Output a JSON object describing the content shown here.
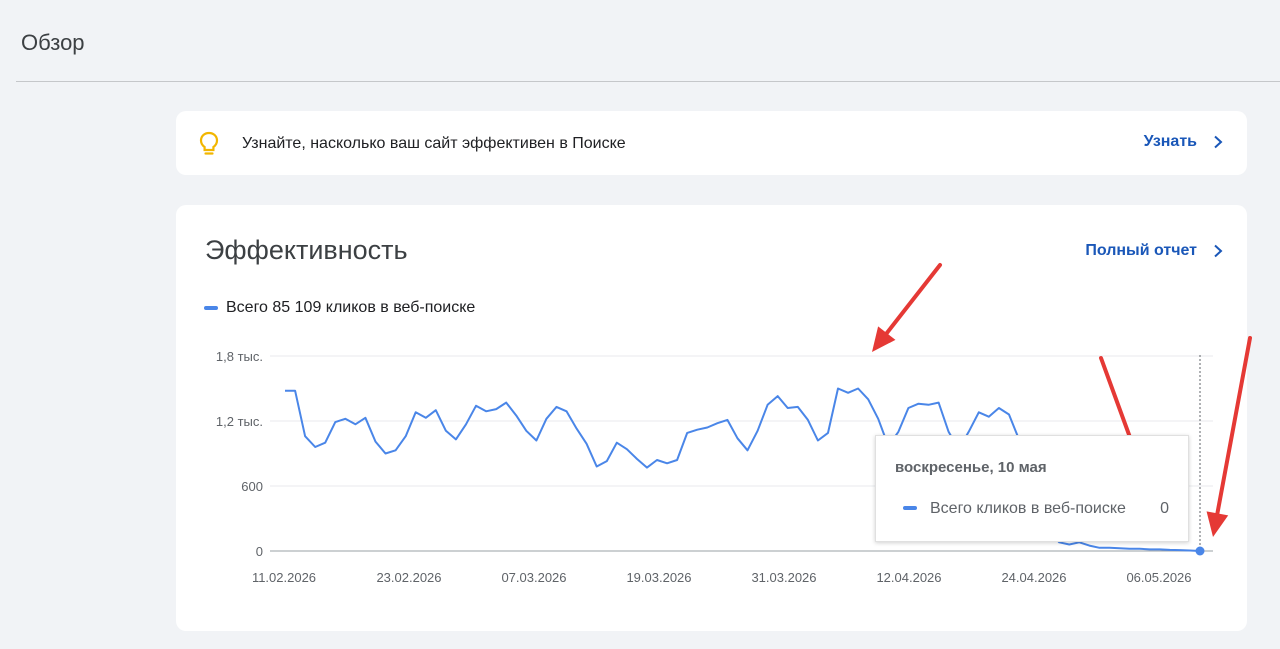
{
  "page": {
    "title": "Обзор"
  },
  "tip": {
    "icon": "lightbulb-icon",
    "icon_color": "#f2b600",
    "text": "Узнайте, насколько ваш сайт эффективен в Поиске",
    "link_label": "Узнать"
  },
  "performance": {
    "title": "Эффективность",
    "link_label": "Полный отчет",
    "legend_label": "Всего 85 109 кликов в веб-поиске",
    "accent": "#1a57b8",
    "series_color": "#4a86e8"
  },
  "tooltip": {
    "date": "воскресенье, 10 мая",
    "label": "Всего кликов в веб-поиске",
    "value": "0"
  },
  "chart_data": {
    "type": "line",
    "ylim": [
      0,
      1800
    ],
    "y_ticks": [
      0,
      600,
      1200,
      1800
    ],
    "y_tick_labels": [
      "0",
      "600",
      "1,2 тыс.",
      "1,8 тыс."
    ],
    "x_tick_labels": [
      "11.02.2026",
      "23.02.2026",
      "07.03.2026",
      "19.03.2026",
      "31.03.2026",
      "12.04.2026",
      "24.04.2026",
      "06.05.2026"
    ],
    "grid": true,
    "series": [
      {
        "values": [
          1480,
          1480,
          1060,
          960,
          1000,
          1190,
          1220,
          1170,
          1230,
          1010,
          900,
          930,
          1060,
          1280,
          1230,
          1300,
          1110,
          1030,
          1170,
          1340,
          1290,
          1310,
          1370,
          1250,
          1110,
          1020,
          1220,
          1330,
          1290,
          1130,
          990,
          780,
          830,
          1000,
          940,
          850,
          770,
          840,
          810,
          840,
          1090,
          1120,
          1140,
          1180,
          1210,
          1040,
          930,
          1110,
          1350,
          1430,
          1320,
          1330,
          1210,
          1020,
          1090,
          1500,
          1460,
          1500,
          1400,
          1220,
          970,
          1100,
          1320,
          1360,
          1350,
          1370,
          1100,
          940,
          1100,
          1280,
          1240,
          1320,
          1260,
          1030,
          820,
          480,
          190,
          80,
          60,
          80,
          50,
          30,
          30,
          25,
          20,
          20,
          15,
          15,
          10,
          8,
          5,
          0
        ]
      }
    ],
    "annotations": [
      {
        "type": "arrow",
        "color": "#e53935"
      },
      {
        "type": "arrow",
        "color": "#e53935"
      },
      {
        "type": "arrow",
        "color": "#e53935"
      }
    ]
  }
}
